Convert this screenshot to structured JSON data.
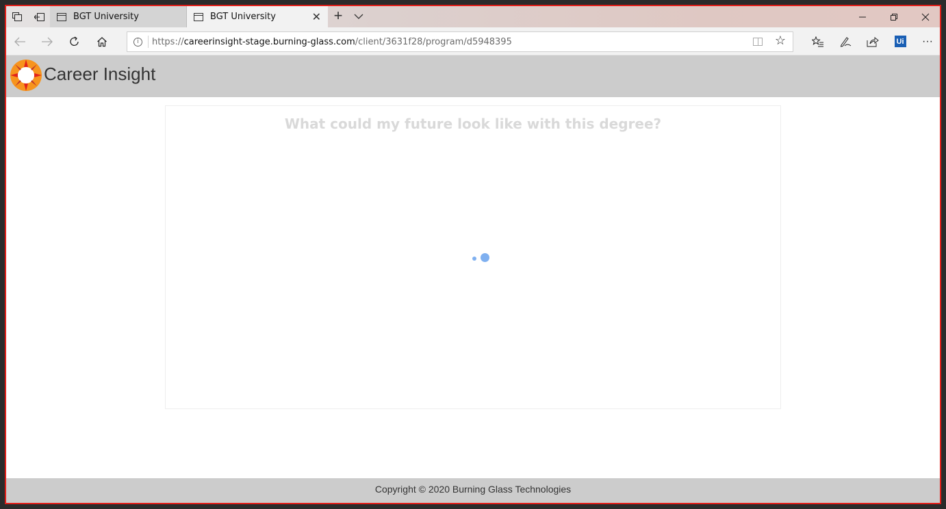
{
  "browser": {
    "tabs": [
      {
        "title": "BGT University",
        "active": false
      },
      {
        "title": "BGT University",
        "active": true
      }
    ],
    "new_tab_symbol": "+",
    "close_symbol": "✕",
    "address": {
      "scheme": "https://",
      "host": "careerinsight-stage.burning-glass.com",
      "path": "/client/3631f28/program/d5948395"
    },
    "toolbar_icons": [
      "back-icon",
      "forward-icon",
      "refresh-icon",
      "home-icon",
      "reading-view-icon",
      "favorite-star-icon",
      "favorites-list-icon",
      "pen-icon",
      "share-icon",
      "uipath-extension-icon",
      "more-icon"
    ],
    "extension_label": "Ui",
    "more_label": "···"
  },
  "app": {
    "title": "Career Insight",
    "card_heading": "What could my future look like with this degree?",
    "loading": true,
    "footer": "Copyright © 2020 Burning Glass Technologies"
  },
  "colors": {
    "window_border": "#e0201b",
    "header_bg": "#cccccc",
    "spinner": "#7fb0f0",
    "logo_orange": "#f7941d",
    "logo_red": "#e2231a"
  }
}
